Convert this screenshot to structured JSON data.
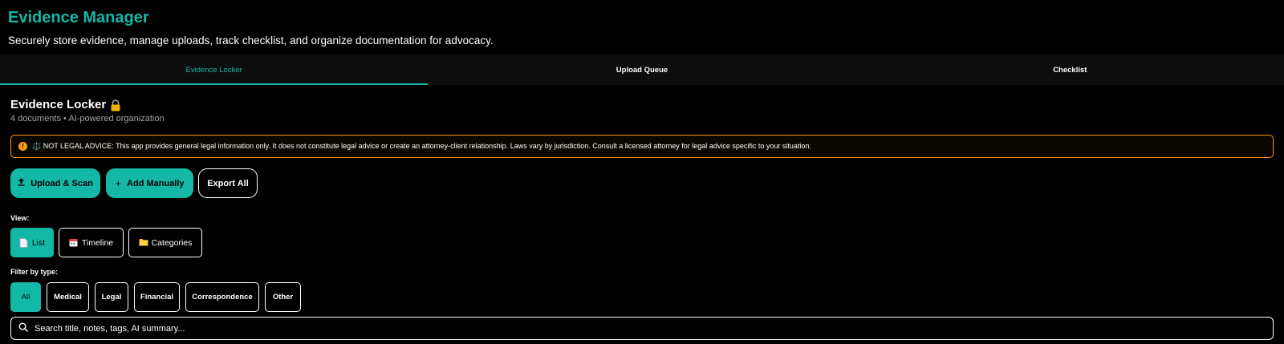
{
  "header": {
    "title": "Evidence Manager",
    "subtitle": "Securely store evidence, manage uploads, track checklist, and organize documentation for advocacy."
  },
  "tabs": [
    {
      "label": "Evidence Locker",
      "active": true
    },
    {
      "label": "Upload Queue",
      "active": false
    },
    {
      "label": "Checklist",
      "active": false
    }
  ],
  "locker": {
    "title": "Evidence Locker",
    "title_icon": "lock-icon",
    "meta": "4 documents • AI-powered organization"
  },
  "disclaimer": {
    "icon": "warning-icon",
    "text": "⚖️ NOT LEGAL ADVICE: This app provides general legal information only. It does not constitute legal advice or create an attorney-client relationship. Laws vary by jurisdiction. Consult a licensed attorney for legal advice specific to your situation."
  },
  "actions": {
    "upload_label": "Upload & Scan",
    "add_label": "Add Manually",
    "export_label": "Export All"
  },
  "view": {
    "label": "View:",
    "options": [
      {
        "label": "List",
        "icon": "document-icon",
        "active": true
      },
      {
        "label": "Timeline",
        "icon": "calendar-icon",
        "active": false
      },
      {
        "label": "Categories",
        "icon": "folder-icon",
        "active": false
      }
    ]
  },
  "filter": {
    "label": "Filter by type:",
    "options": [
      {
        "label": "All",
        "active": true
      },
      {
        "label": "Medical",
        "active": false
      },
      {
        "label": "Legal",
        "active": false
      },
      {
        "label": "Financial",
        "active": false
      },
      {
        "label": "Correspondence",
        "active": false
      },
      {
        "label": "Other",
        "active": false
      }
    ]
  },
  "search": {
    "placeholder": "Search title, notes, tags, AI summary..."
  },
  "colors": {
    "accent": "#14b8a6",
    "warning": "#f59e0b",
    "background": "#000000"
  }
}
